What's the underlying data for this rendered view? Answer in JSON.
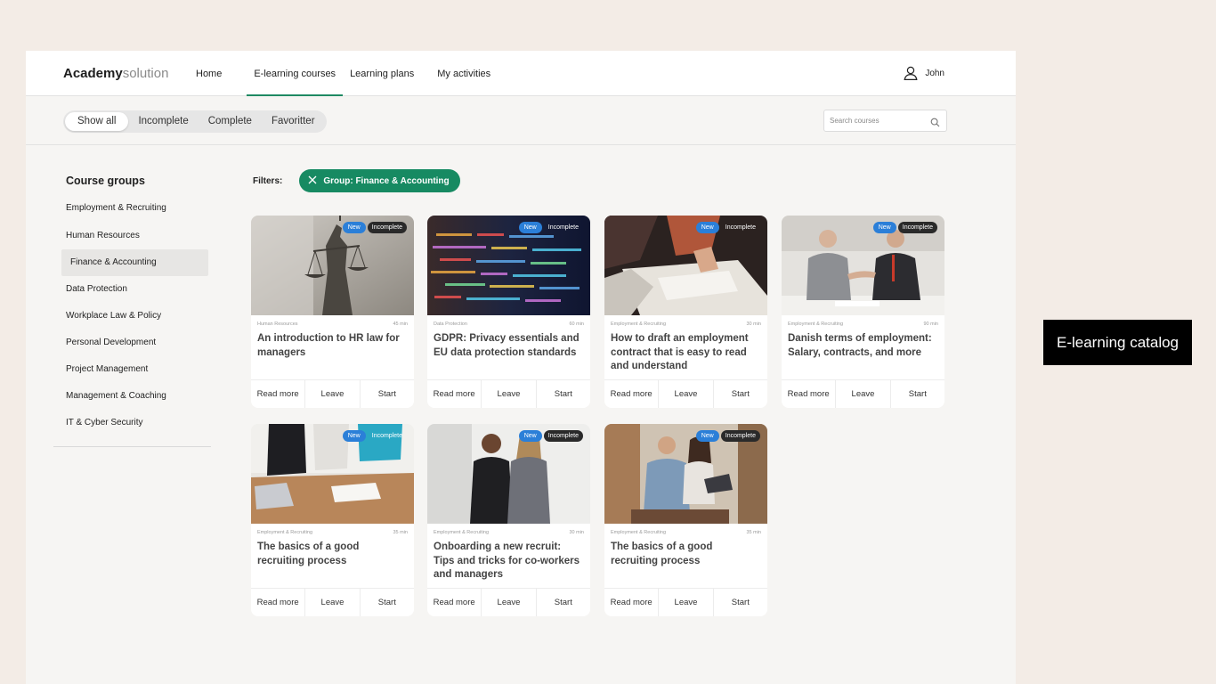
{
  "logo": {
    "bold": "Academy",
    "light": "solution"
  },
  "nav": {
    "items": [
      {
        "label": "Home"
      },
      {
        "label": "E-learning courses"
      },
      {
        "label": "Learning plans"
      },
      {
        "label": "My activities"
      }
    ],
    "active_index": 1
  },
  "user": {
    "name": "John",
    "icon": "user-icon"
  },
  "tabs": {
    "items": [
      {
        "label": "Show all"
      },
      {
        "label": "Incomplete"
      },
      {
        "label": "Complete"
      },
      {
        "label": "Favoritter"
      }
    ],
    "active_index": 0
  },
  "search": {
    "placeholder": "Search courses",
    "value": ""
  },
  "sidebar": {
    "title": "Course groups",
    "items": [
      {
        "label": "Employment & Recruiting"
      },
      {
        "label": "Human Resources"
      },
      {
        "label": "Finance & Accounting"
      },
      {
        "label": "Data Protection"
      },
      {
        "label": "Workplace Law & Policy"
      },
      {
        "label": "Personal Development"
      },
      {
        "label": "Project Management"
      },
      {
        "label": "Management & Coaching"
      },
      {
        "label": "IT & Cyber Security"
      }
    ],
    "active_index": 2
  },
  "filters": {
    "label": "Filters:",
    "chip": "Group: Finance & Accounting"
  },
  "badges": {
    "new": "New",
    "status": "Incomplete"
  },
  "actions": {
    "read_more": "Read more",
    "leave": "Leave",
    "start": "Start"
  },
  "courses": [
    {
      "category": "Human Resources",
      "duration": "45 min",
      "title": "An introduction to HR law for managers",
      "image": "justice-statue"
    },
    {
      "category": "Data Protection",
      "duration": "60 min",
      "title": "GDPR: Privacy essentials and EU data protection standards",
      "image": "code-screen"
    },
    {
      "category": "Employment & Recruiting",
      "duration": "30 min",
      "title": "How to draft an employment contract that is easy to read and understand",
      "image": "signing-contract"
    },
    {
      "category": "Employment & Recruiting",
      "duration": "90 min",
      "title": "Danish terms of employment: Salary, contracts, and more",
      "image": "handshake-meeting"
    },
    {
      "category": "Employment & Recruiting",
      "duration": "35 min",
      "title": "The basics of a good recruiting process",
      "image": "team-at-desk"
    },
    {
      "category": "Employment & Recruiting",
      "duration": "30 min",
      "title": "Onboarding a new recruit: Tips and tricks for co-workers and managers",
      "image": "two-colleagues"
    },
    {
      "category": "Employment & Recruiting",
      "duration": "35 min",
      "title": "The basics of a good recruiting process",
      "image": "couple-laptop"
    }
  ],
  "aside_label": "E-learning catalog"
}
